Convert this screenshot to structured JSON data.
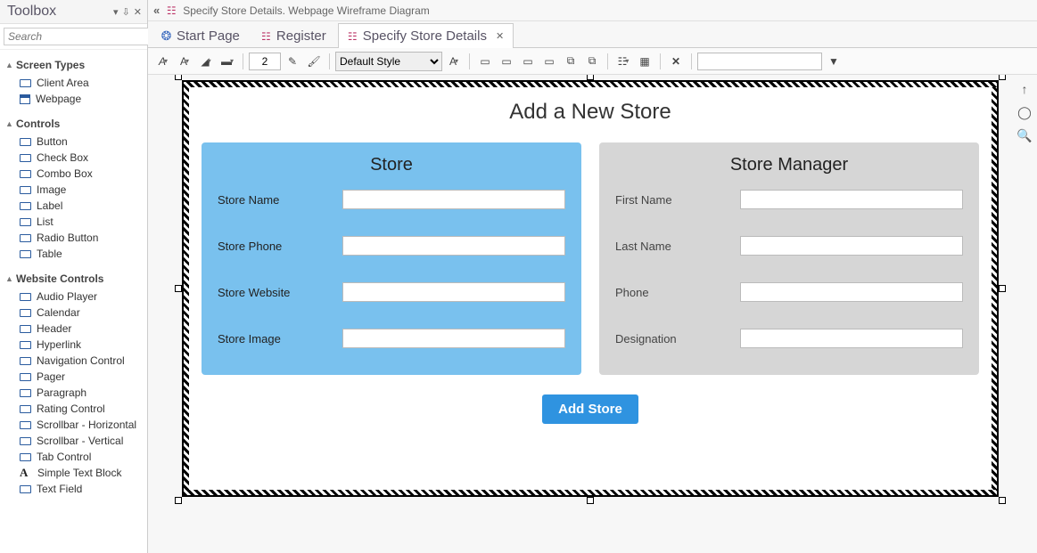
{
  "toolbox": {
    "title": "Toolbox",
    "search_placeholder": "Search",
    "groups": [
      {
        "name": "Screen Types",
        "items": [
          "Client Area",
          "Webpage"
        ]
      },
      {
        "name": "Controls",
        "items": [
          "Button",
          "Check Box",
          "Combo Box",
          "Image",
          "Label",
          "List",
          "Radio Button",
          "Table"
        ]
      },
      {
        "name": "Website Controls",
        "items": [
          "Audio Player",
          "Calendar",
          "Header",
          "Hyperlink",
          "Navigation Control",
          "Pager",
          "Paragraph",
          "Rating Control",
          "Scrollbar - Horizontal",
          "Scrollbar - Vertical",
          "Tab Control",
          "Simple Text Block",
          "Text Field"
        ]
      }
    ]
  },
  "breadcrumb": {
    "text": "Specify Store Details.  Webpage Wireframe Diagram"
  },
  "tabs": [
    {
      "label": "Start Page",
      "icon": "start",
      "active": false,
      "closable": false
    },
    {
      "label": "Register",
      "icon": "tree",
      "active": false,
      "closable": false
    },
    {
      "label": "Specify Store Details",
      "icon": "tree",
      "active": true,
      "closable": true
    }
  ],
  "toolbar": {
    "line_width": "2",
    "style_select": "Default Style"
  },
  "wireframe": {
    "title": "Add a New Store",
    "panels": {
      "store": {
        "title": "Store",
        "fields": [
          "Store Name",
          "Store Phone",
          "Store Website",
          "Store Image"
        ]
      },
      "manager": {
        "title": "Store Manager",
        "fields": [
          "First Name",
          "Last Name",
          "Phone",
          "Designation"
        ]
      }
    },
    "button_label": "Add Store"
  }
}
